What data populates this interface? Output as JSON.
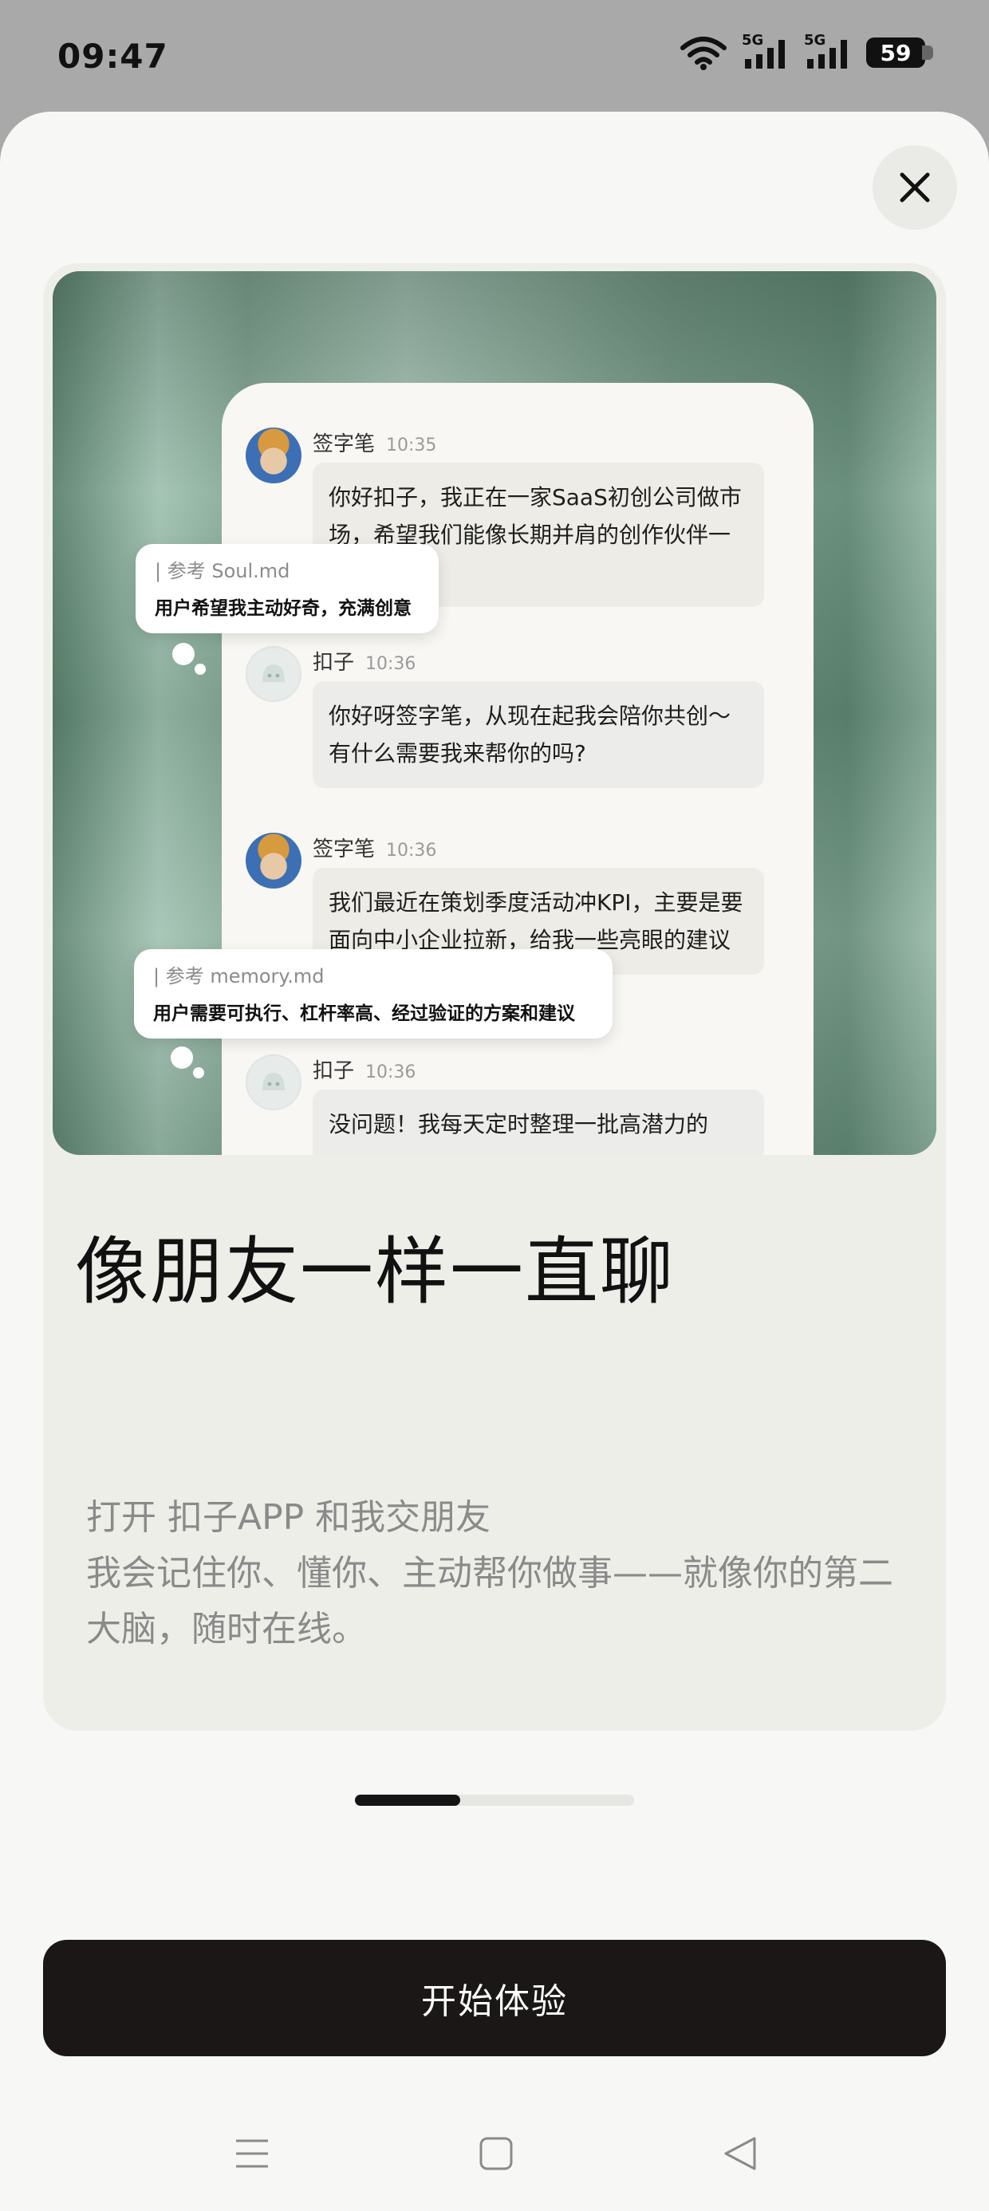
{
  "status_bar": {
    "time": "09:47",
    "network_1": "5G",
    "network_2": "5G",
    "battery": "59"
  },
  "dialog": {
    "close_icon": "close-icon",
    "preview": {
      "messages": [
        {
          "sender": "签字笔",
          "time": "10:35",
          "text": "你好扣子，我正在一家SaaS初创公司做市场，希望我们能像长期并肩的创作伙伴一样相处。"
        },
        {
          "sender": "扣子",
          "time": "10:36",
          "text": "你好呀签字笔，从现在起我会陪你共创～有什么需要我来帮你的吗?"
        },
        {
          "sender": "签字笔",
          "time": "10:36",
          "text": "我们最近在策划季度活动冲KPI，主要是要面向中小企业拉新，给我一些亮眼的建议"
        },
        {
          "sender": "扣子",
          "time": "10:36",
          "text": "没问题！我每天定时整理一批高潜力的"
        }
      ],
      "notes": [
        {
          "ref": "| 参考 Soul.md",
          "text": "用户希望我主动好奇，充满创意"
        },
        {
          "ref": "| 参考 memory.md",
          "text": "用户需要可执行、杠杆率高、经过验证的方案和建议"
        }
      ]
    },
    "title": "像朋友一样一直聊",
    "description_line1": "打开 扣子APP 和我交朋友",
    "description_line2": "我会记住你、懂你、主动帮你做事——就像你的第二大脑，随时在线。",
    "pager": {
      "current": 1,
      "total": 3
    },
    "cta_label": "开始体验"
  },
  "navbar": {
    "icons": [
      "menu-icon",
      "home-icon",
      "back-icon"
    ]
  }
}
